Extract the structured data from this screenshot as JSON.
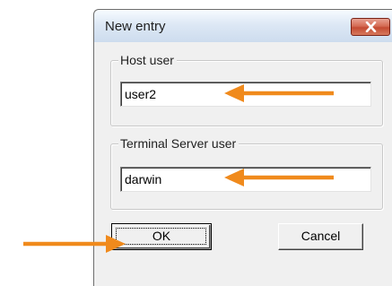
{
  "dialog": {
    "title": "New entry",
    "close_icon": "close-x-icon",
    "host_user": {
      "label": "Host user",
      "value": "user2"
    },
    "terminal_server_user": {
      "label": "Terminal Server user",
      "value": "darwin"
    },
    "ok_label": "OK",
    "cancel_label": "Cancel"
  },
  "annotations": {
    "arrow_color": "#f08a1c",
    "arrow_icon": "arrow-left-icon"
  }
}
